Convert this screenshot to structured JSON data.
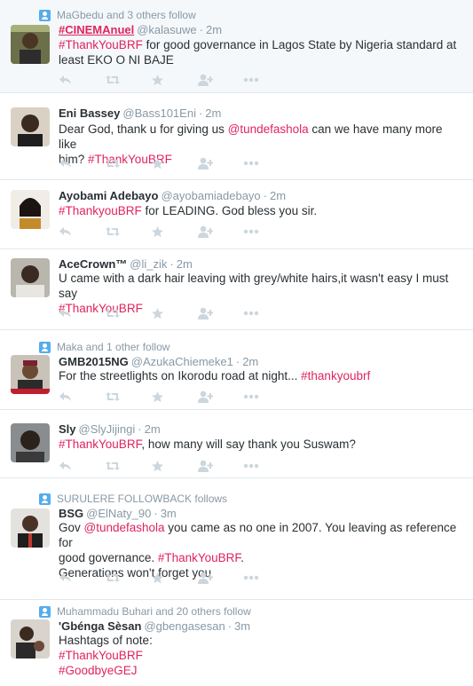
{
  "tweets": [
    {
      "context": "MaGbedu and 3 others follow",
      "name": "#CINEMAnuel",
      "handle": "@kalasuwe",
      "time": "2m",
      "lines": [
        [
          {
            "t": "#ThankYouBRF",
            "c": "tag"
          },
          {
            "t": " for good governance in Lagos State by Nigeria standard at"
          }
        ],
        [
          {
            "t": "least EKO O NI BAJE"
          }
        ]
      ]
    },
    {
      "context": "",
      "name": "Eni Bassey",
      "handle": "@Bass101Eni",
      "time": "2m",
      "lines": [
        [
          {
            "t": "Dear God, thank u for giving us "
          },
          {
            "t": "@tundefashola",
            "c": "mention"
          },
          {
            "t": " can we have many more like"
          }
        ],
        [
          {
            "t": "him? "
          },
          {
            "t": "#ThankYouBRF",
            "c": "tag"
          }
        ]
      ]
    },
    {
      "context": "",
      "name": "Ayobami Adebayo",
      "handle": "@ayobamiadebayo",
      "time": "2m",
      "lines": [
        [
          {
            "t": "#ThankyouBRF",
            "c": "tag"
          },
          {
            "t": " for LEADING. God bless you sir."
          }
        ]
      ]
    },
    {
      "context": "",
      "name": "AceCrown™",
      "handle": "@li_zik",
      "time": "2m",
      "lines": [
        [
          {
            "t": "U came with a dark hair leaving with grey/white hairs,it wasn't easy I must say"
          }
        ],
        [
          {
            "t": "#ThankYouBRF",
            "c": "tag"
          }
        ]
      ]
    },
    {
      "context": "Maka and 1 other follow",
      "name": "GMB2015NG",
      "handle": "@AzukaChiemeke1",
      "time": "2m",
      "lines": [
        [
          {
            "t": "For the streetlights on Ikorodu road at night... "
          },
          {
            "t": "#thankyoubrf",
            "c": "tag"
          }
        ]
      ]
    },
    {
      "context": "",
      "name": "Sly",
      "handle": "@SlyJijingi",
      "time": "2m",
      "lines": [
        [
          {
            "t": "#ThankYouBRF",
            "c": "tag"
          },
          {
            "t": ", how many will say thank you Suswam?"
          }
        ]
      ]
    },
    {
      "context": "SURULERE FOLLOWBACK follows",
      "name": "BSG",
      "handle": "@ElNaty_90",
      "time": "3m",
      "lines": [
        [
          {
            "t": "Gov "
          },
          {
            "t": "@tundefashola",
            "c": "mention"
          },
          {
            "t": " you came as no one in 2007. You leaving as reference for"
          }
        ],
        [
          {
            "t": "good governance. "
          },
          {
            "t": "#ThankYouBRF",
            "c": "tag"
          },
          {
            "t": "."
          }
        ],
        [
          {
            "t": "Generations won't forget you"
          }
        ]
      ]
    },
    {
      "context": "Muhammadu Buhari and 20 others follow",
      "name": "'Gbénga Sèsan",
      "handle": "@gbengasesan",
      "time": "3m",
      "lines": [
        [
          {
            "t": "Hashtags of note:"
          }
        ],
        [
          {
            "t": "#ThankYouBRF",
            "c": "tag"
          }
        ],
        [
          {
            "t": "#GoodbyeGEJ",
            "c": "tag"
          }
        ]
      ]
    }
  ],
  "colors": {
    "hashtag": "#e0245e",
    "secondary_text": "#8899a6",
    "action_icon": "#ccd6dd",
    "context_icon": "#55acee"
  },
  "action_icons": [
    "reply-icon",
    "retweet-icon",
    "favorite-icon",
    "follow-icon",
    "more-icon"
  ]
}
